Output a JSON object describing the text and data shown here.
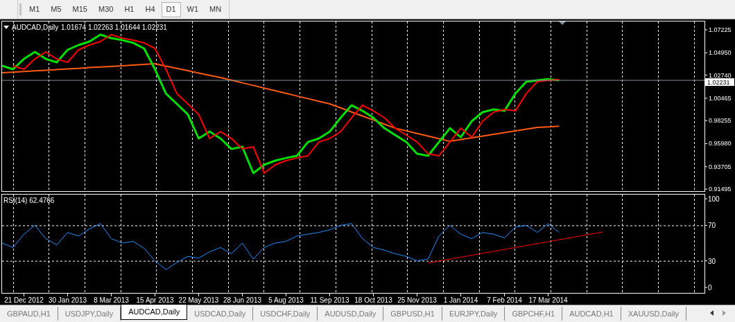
{
  "toolbar": {
    "timeframes": [
      {
        "label": "M1",
        "selected": false
      },
      {
        "label": "M5",
        "selected": false
      },
      {
        "label": "M15",
        "selected": false
      },
      {
        "label": "M30",
        "selected": false
      },
      {
        "label": "H1",
        "selected": false
      },
      {
        "label": "H4",
        "selected": false
      },
      {
        "label": "D1",
        "selected": true
      },
      {
        "label": "W1",
        "selected": false
      },
      {
        "label": "MN",
        "selected": false
      }
    ]
  },
  "price_chart": {
    "header": {
      "symbol": "AUDCAD,Daily",
      "values": [
        "1.01674",
        "1.02263",
        "1.01644",
        "1.02231"
      ]
    },
    "current_price": "1.02231",
    "chart_data": {
      "type": "line",
      "grid": true,
      "categories": [
        null,
        null,
        null,
        null,
        null,
        null,
        null,
        null,
        null,
        null,
        null,
        null,
        null,
        null,
        null,
        null,
        null,
        null,
        null,
        null,
        null,
        null,
        null,
        null,
        null,
        null,
        null,
        null,
        null,
        null,
        null,
        null,
        null,
        null,
        null,
        null,
        null,
        null,
        null,
        null,
        null,
        null,
        null,
        null,
        null,
        null,
        null,
        null,
        null,
        null,
        null,
        null,
        null,
        null,
        null,
        null
      ],
      "ylim": [
        0.9126,
        1.0808
      ],
      "yticks": [
        {
          "value": 1.07225,
          "label": "1.07225"
        },
        {
          "value": 1.0495,
          "label": "1.04950"
        },
        {
          "value": 1.0274,
          "label": "1.02740"
        },
        {
          "value": 1.00465,
          "label": "1.00465"
        },
        {
          "value": 0.98255,
          "label": "0.98255"
        },
        {
          "value": 0.9598,
          "label": "0.95980"
        },
        {
          "value": 0.93705,
          "label": "0.93705"
        },
        {
          "value": 0.91495,
          "label": "0.91495"
        }
      ],
      "ref_lines": [
        {
          "axis": "y",
          "value": 1.02231,
          "color": "#8090a0"
        }
      ],
      "series": [
        {
          "color": "#00e000",
          "values": [
            1.0367,
            1.0333,
            1.0435,
            1.0504,
            1.0435,
            1.0401,
            1.0524,
            1.0572,
            1.0606,
            1.0675,
            1.064,
            1.062,
            1.0593,
            1.0538,
            1.0333,
            1.0093,
            0.9991,
            0.9888,
            0.9649,
            0.9717,
            0.9649,
            0.9546,
            0.9567,
            0.9307,
            0.9389,
            0.943,
            0.9457,
            0.9478,
            0.9614,
            0.9649,
            0.9717,
            0.9854,
            0.9977,
            0.9922,
            0.9854,
            0.9751,
            0.9683,
            0.9614,
            0.9498,
            0.9478,
            0.9614,
            0.9751,
            0.9662,
            0.982,
            0.9909,
            0.9936,
            0.9922,
            1.0093,
            1.021,
            1.0223,
            1.0235,
            1.0223,
            null,
            null,
            null,
            null
          ]
        },
        {
          "color": "#ff0000",
          "values": [
            null,
            1.0367,
            1.0333,
            1.0435,
            1.0504,
            1.0435,
            1.0401,
            1.0524,
            1.0572,
            1.0606,
            1.0675,
            1.064,
            1.062,
            1.0593,
            1.0538,
            1.0333,
            1.0093,
            0.9991,
            0.9888,
            0.9649,
            0.9717,
            0.9649,
            0.9546,
            0.9567,
            0.9307,
            0.9389,
            0.943,
            0.9457,
            0.9478,
            0.9614,
            0.9649,
            0.9717,
            0.9854,
            0.9977,
            0.9922,
            0.9854,
            0.9751,
            0.9683,
            0.9614,
            0.9498,
            0.9478,
            0.9614,
            0.9751,
            0.9662,
            0.982,
            0.9909,
            0.9936,
            0.9922,
            1.0093,
            1.021,
            1.0223,
            1.023,
            null,
            null,
            null,
            null
          ]
        },
        {
          "color": "#ff5a14",
          "values": [
            1.0298,
            1.0304,
            1.0311,
            1.0317,
            1.0323,
            1.033,
            1.0336,
            1.0342,
            1.0349,
            1.0355,
            1.0361,
            1.0368,
            1.0374,
            1.038,
            1.0387,
            1.0364,
            1.0341,
            1.0319,
            1.0296,
            1.0273,
            1.0251,
            1.0225,
            1.0199,
            1.0173,
            1.0147,
            1.0121,
            1.0095,
            1.0069,
            1.0043,
            1.0017,
            0.9991,
            0.9951,
            0.9911,
            0.9871,
            0.9831,
            0.9791,
            0.9751,
            0.9725,
            0.9699,
            0.9673,
            0.9647,
            0.9621,
            0.9638,
            0.9655,
            0.9672,
            0.969,
            0.9707,
            0.9724,
            0.9741,
            0.9758,
            0.9764,
            0.977,
            null,
            null,
            null,
            null
          ]
        }
      ]
    }
  },
  "rsi_chart": {
    "header": "RSI(14) 62.4766",
    "chart_data": {
      "type": "line",
      "grid": true,
      "categories": [
        null,
        null,
        "21 Dec 2012",
        null,
        null,
        null,
        "30 Jan 2013",
        null,
        null,
        null,
        "8 Mar 2013",
        null,
        null,
        null,
        "15 Apr 2013",
        null,
        null,
        null,
        "22 May 2013",
        null,
        null,
        null,
        "28 Jun 2013",
        null,
        null,
        null,
        "5 Aug 2013",
        null,
        null,
        null,
        "11 Sep 2013",
        null,
        null,
        null,
        "18 Oct 2013",
        null,
        null,
        null,
        "25 Nov 2013",
        null,
        null,
        null,
        "1 Jan 2014",
        null,
        null,
        null,
        "7 Feb 2014",
        null,
        null,
        null,
        "17 Mar 2014",
        null,
        null,
        null,
        null,
        null
      ],
      "ylim": [
        -6.6,
        105.1
      ],
      "yticks": [
        0,
        30,
        70,
        100
      ],
      "series": [
        {
          "color": "#1e90ff",
          "values": [
            50,
            45,
            60,
            70,
            55,
            48,
            62,
            58,
            66,
            72,
            55,
            50,
            52,
            44,
            30,
            20,
            28,
            35,
            33,
            40,
            45,
            38,
            50,
            32,
            45,
            50,
            52,
            58,
            60,
            62,
            65,
            70,
            72,
            55,
            45,
            42,
            38,
            35,
            30,
            32,
            58,
            70,
            60,
            55,
            62,
            60,
            56,
            68,
            70,
            62,
            72,
            62,
            null,
            null,
            null,
            null
          ]
        },
        {
          "color": "#ff0000",
          "values": [
            null,
            null,
            null,
            null,
            null,
            null,
            null,
            null,
            null,
            null,
            null,
            null,
            null,
            null,
            null,
            null,
            null,
            null,
            null,
            null,
            null,
            null,
            null,
            null,
            null,
            null,
            null,
            null,
            null,
            null,
            null,
            null,
            null,
            null,
            null,
            null,
            null,
            null,
            null,
            27.5,
            null,
            null,
            null,
            null,
            null,
            null,
            null,
            null,
            null,
            null,
            null,
            null,
            null,
            null,
            null,
            62.5
          ]
        }
      ]
    }
  },
  "tabs": [
    {
      "label": "GBPAUD,H1",
      "selected": false
    },
    {
      "label": "USDJPY,Daily",
      "selected": false
    },
    {
      "label": "AUDCAD,Daily",
      "selected": true
    },
    {
      "label": "USDCAD,Daily",
      "selected": false
    },
    {
      "label": "USDCHF,Daily",
      "selected": false
    },
    {
      "label": "AUDUSD,Daily",
      "selected": false
    },
    {
      "label": "GBPUSD,H1",
      "selected": false
    },
    {
      "label": "EURJPY,Daily",
      "selected": false
    },
    {
      "label": "GBPCHF,H1",
      "selected": false
    },
    {
      "label": "AUDCAD,H1",
      "selected": false
    },
    {
      "label": "XAUUSD,Daily",
      "selected": false
    }
  ]
}
